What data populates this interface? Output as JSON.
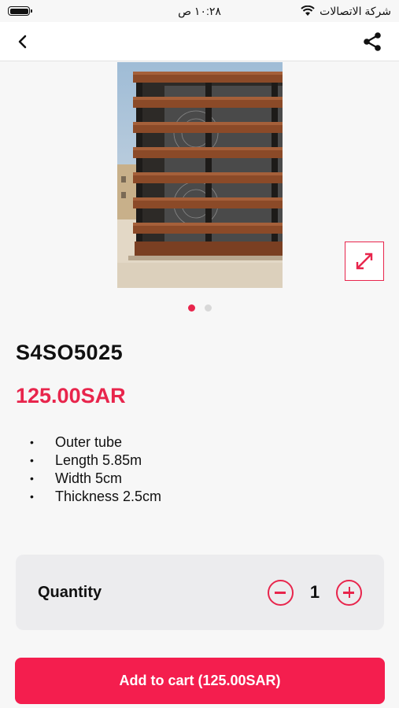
{
  "status_bar": {
    "time": "١٠:٢٨ ص",
    "carrier": "شركة الاتصالات"
  },
  "product": {
    "code": "S4SO5025",
    "price": "125.00SAR",
    "features": [
      "Outer tube",
      "Length 5.85m",
      "Width 5cm",
      "Thickness 2.5cm"
    ],
    "image_count": 2,
    "active_image": 1
  },
  "quantity": {
    "label": "Quantity",
    "value": "1"
  },
  "cart": {
    "button_label": "Add to cart (125.00SAR)"
  },
  "icons": {
    "back": "chevron-left-icon",
    "share": "share-icon",
    "expand": "expand-icon",
    "minus": "minus-circle-icon",
    "plus": "plus-circle-icon"
  },
  "colors": {
    "accent": "#e8254c",
    "button": "#f41e4e"
  }
}
